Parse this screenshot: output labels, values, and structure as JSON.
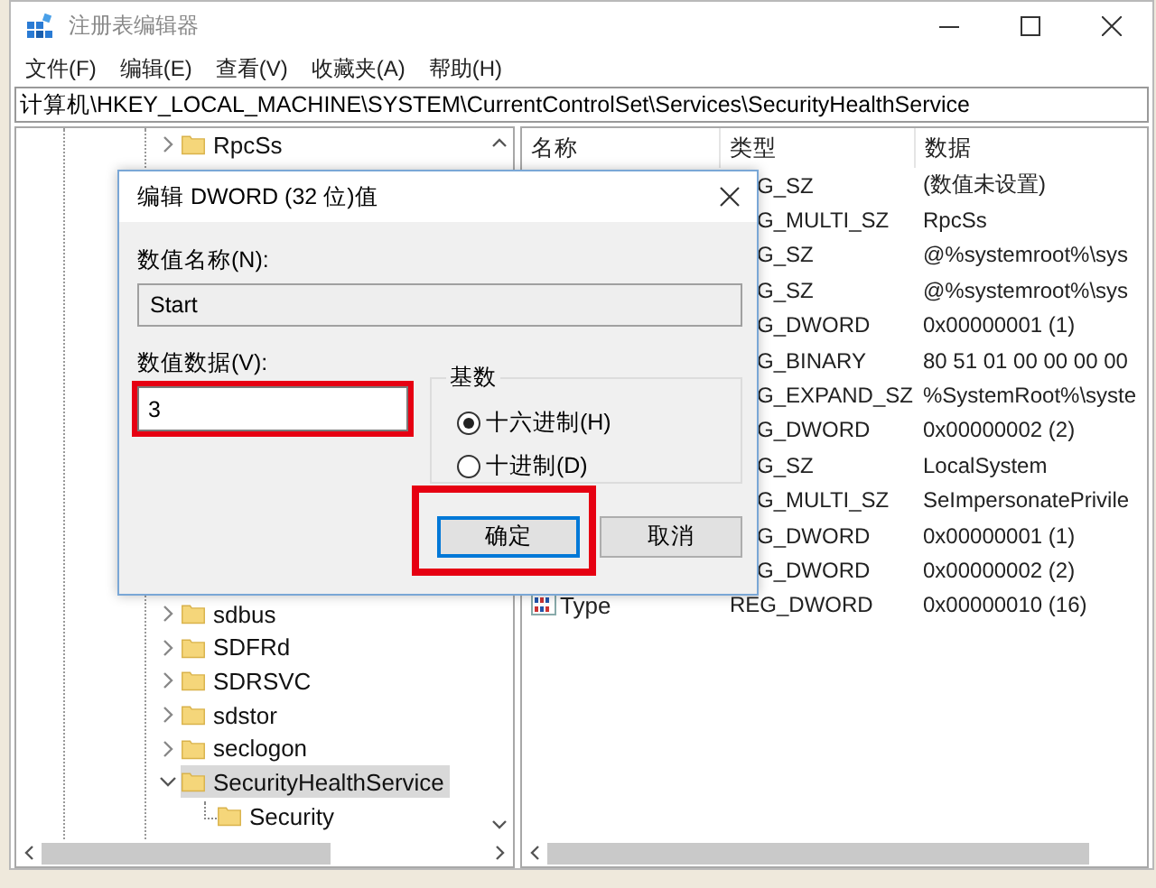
{
  "window": {
    "title": "注册表编辑器"
  },
  "menu": [
    "文件(F)",
    "编辑(E)",
    "查看(V)",
    "收藏夹(A)",
    "帮助(H)"
  ],
  "address": "计算机\\HKEY_LOCAL_MACHINE\\SYSTEM\\CurrentControlSet\\Services\\SecurityHealthService",
  "tree": [
    {
      "label": "RpcSs",
      "expanded": false,
      "selected": false
    },
    {
      "label": "sdbus",
      "expanded": false,
      "selected": false
    },
    {
      "label": "SDFRd",
      "expanded": false,
      "selected": false
    },
    {
      "label": "SDRSVC",
      "expanded": false,
      "selected": false
    },
    {
      "label": "sdstor",
      "expanded": false,
      "selected": false
    },
    {
      "label": "seclogon",
      "expanded": false,
      "selected": false
    },
    {
      "label": "SecurityHealthService",
      "expanded": true,
      "selected": true,
      "children": [
        {
          "label": "Security",
          "selected": false
        }
      ]
    }
  ],
  "values": {
    "columns": [
      "名称",
      "类型",
      "数据"
    ],
    "rows": [
      {
        "type": "G_SZ",
        "data": "(数值未设置)"
      },
      {
        "type": "G_MULTI_SZ",
        "data": "RpcSs"
      },
      {
        "type": "G_SZ",
        "data": "@%systemroot%\\sys"
      },
      {
        "type": "G_SZ",
        "data": "@%systemroot%\\sys"
      },
      {
        "type": "G_DWORD",
        "data": "0x00000001 (1)"
      },
      {
        "type": "G_BINARY",
        "data": "80 51 01 00 00 00 00"
      },
      {
        "type": "G_EXPAND_SZ",
        "data": "%SystemRoot%\\syste"
      },
      {
        "type": "G_DWORD",
        "data": "0x00000002 (2)"
      },
      {
        "type": "G_SZ",
        "data": "LocalSystem"
      },
      {
        "type": "G_MULTI_SZ",
        "data": "SeImpersonatePrivile"
      },
      {
        "type": "G_DWORD",
        "data": "0x00000001 (1)"
      },
      {
        "type": "G_DWORD",
        "data": "0x00000002 (2)"
      },
      {
        "name": "Type",
        "type": "REG_DWORD",
        "data": "0x00000010 (16)"
      }
    ]
  },
  "dialog": {
    "title": "编辑 DWORD (32 位)值",
    "name_label": "数值名称(N):",
    "name_value": "Start",
    "data_label": "数值数据(V):",
    "data_value": "3",
    "data_highlighted": true,
    "base": {
      "label": "基数",
      "options": [
        {
          "label": "十六进制(H)",
          "selected": true
        },
        {
          "label": "十进制(D)",
          "selected": false
        }
      ]
    },
    "buttons": [
      {
        "label": "确定",
        "default": true,
        "highlighted": true
      },
      {
        "label": "取消",
        "default": false,
        "highlighted": false
      }
    ]
  }
}
